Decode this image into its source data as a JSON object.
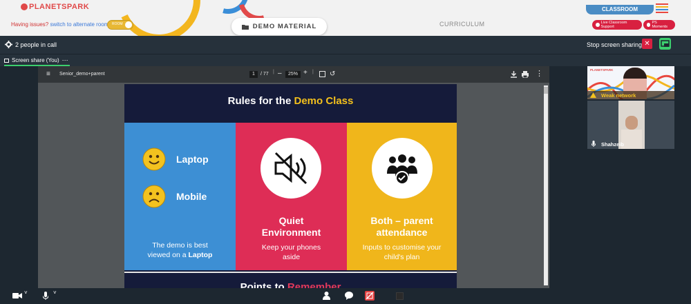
{
  "app": {
    "logo_text": "PLANETSPARK",
    "issues_text": "Having issues?",
    "issues_link": "switch to alternate room",
    "toggle_label": "ROOM",
    "demo_material_label": "DEMO MATERIAL",
    "curriculum_label": "CURRICULUM",
    "classroom_tab": "CLASSROOM",
    "live_support_label": "Live Classroom Support",
    "ps_moments_label": "PS Moments",
    "colors": {
      "accent_red": "#d82040",
      "brand_blue": "#4a8cc4",
      "toggle_yellow": "#e8b834"
    }
  },
  "call": {
    "people_label": "2 people in call",
    "stop_sharing_label": "Stop screen sharing",
    "screen_share_tab": "Screen share (You)"
  },
  "pdf": {
    "filename": "Senior_demo+parent",
    "page_current": "1",
    "page_total": "/ 77",
    "zoom": "25%"
  },
  "slide": {
    "title_part1": "Rules for the ",
    "title_part2": "Demo Class",
    "col1": {
      "laptop": "Laptop",
      "mobile": "Mobile",
      "sub_line1": "The demo is best",
      "sub_line2_pre": "viewed on a ",
      "sub_line2_bold": "Laptop"
    },
    "col2": {
      "head_line1": "Quiet",
      "head_line2": "Environment",
      "sub_line1": "Keep your phones",
      "sub_line2": "aside"
    },
    "col3": {
      "head_line1": "Both – parent",
      "head_line2": "attendance",
      "sub_line1": "Inputs to customise your",
      "sub_line2": "child's plan"
    },
    "next_title_part1": "Points to ",
    "next_title_part2": "Remember"
  },
  "participants": {
    "p1_warning": "Weak network",
    "p2_name": "Shahzeib",
    "p1_logo": "PLANETSPARK"
  },
  "icons": [
    "video-icon",
    "mic-icon",
    "person-icon",
    "chat-icon",
    "share-off-icon",
    "square-icon",
    "gear-icon",
    "close-icon",
    "download-icon",
    "print-icon",
    "more-icon"
  ]
}
